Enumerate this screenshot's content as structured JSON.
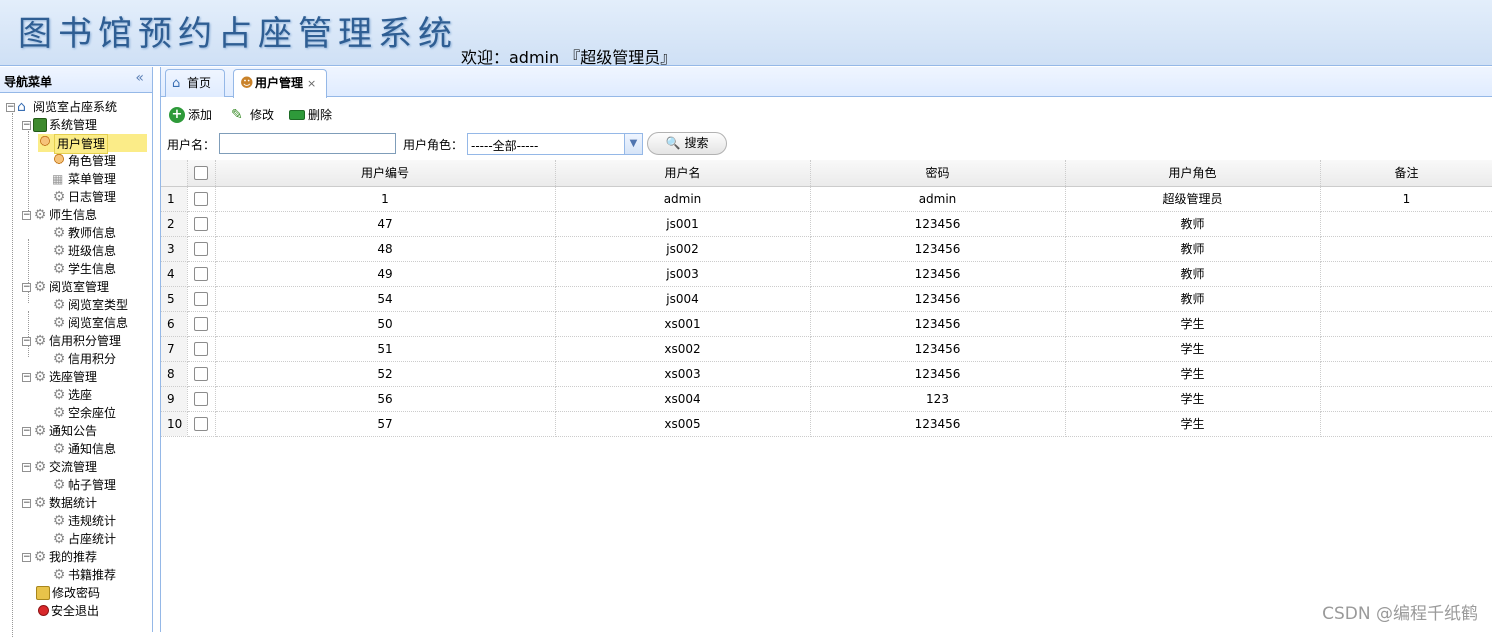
{
  "header": {
    "title": "图书馆预约占座管理系统",
    "welcome": "欢迎：admin 『超级管理员』"
  },
  "sidebar": {
    "title": "导航菜单",
    "tree": {
      "root": "阅览室占座系统",
      "sys": "系统管理",
      "user_mgmt": "用户管理",
      "role_mgmt": "角色管理",
      "menu_mgmt": "菜单管理",
      "log_mgmt": "日志管理",
      "ts_info": "师生信息",
      "teacher_info": "教师信息",
      "class_info": "班级信息",
      "student_info": "学生信息",
      "room_mgmt": "阅览室管理",
      "room_type": "阅览室类型",
      "room_info": "阅览室信息",
      "credit_mgmt": "信用积分管理",
      "credit": "信用积分",
      "seat_mgmt": "选座管理",
      "seat_select": "选座",
      "free_seat": "空余座位",
      "notice": "通知公告",
      "notice_info": "通知信息",
      "comm_mgmt": "交流管理",
      "post_mgmt": "帖子管理",
      "stats": "数据统计",
      "violation_stats": "违规统计",
      "seat_stats": "占座统计",
      "recommend": "我的推荐",
      "book_recommend": "书籍推荐",
      "change_pwd": "修改密码",
      "logout": "安全退出"
    }
  },
  "tabs": {
    "home": "首页",
    "users": "用户管理"
  },
  "toolbar": {
    "add": "添加",
    "edit": "修改",
    "delete": "删除"
  },
  "search": {
    "name_label": "用户名：",
    "name_value": "",
    "role_label": "用户角色：",
    "role_value": "-----全部-----",
    "button": "搜索"
  },
  "grid": {
    "columns": [
      "用户编号",
      "用户名",
      "密码",
      "用户角色",
      "备注"
    ],
    "rows": [
      [
        "1",
        "1",
        "admin",
        "admin",
        "超级管理员",
        "1"
      ],
      [
        "2",
        "47",
        "js001",
        "123456",
        "教师",
        ""
      ],
      [
        "3",
        "48",
        "js002",
        "123456",
        "教师",
        ""
      ],
      [
        "4",
        "49",
        "js003",
        "123456",
        "教师",
        ""
      ],
      [
        "5",
        "54",
        "js004",
        "123456",
        "教师",
        ""
      ],
      [
        "6",
        "50",
        "xs001",
        "123456",
        "学生",
        ""
      ],
      [
        "7",
        "51",
        "xs002",
        "123456",
        "学生",
        ""
      ],
      [
        "8",
        "52",
        "xs003",
        "123456",
        "学生",
        ""
      ],
      [
        "9",
        "56",
        "xs004",
        "123",
        "学生",
        ""
      ],
      [
        "10",
        "57",
        "xs005",
        "123456",
        "学生",
        ""
      ]
    ]
  },
  "watermark": "CSDN @编程千纸鹤"
}
